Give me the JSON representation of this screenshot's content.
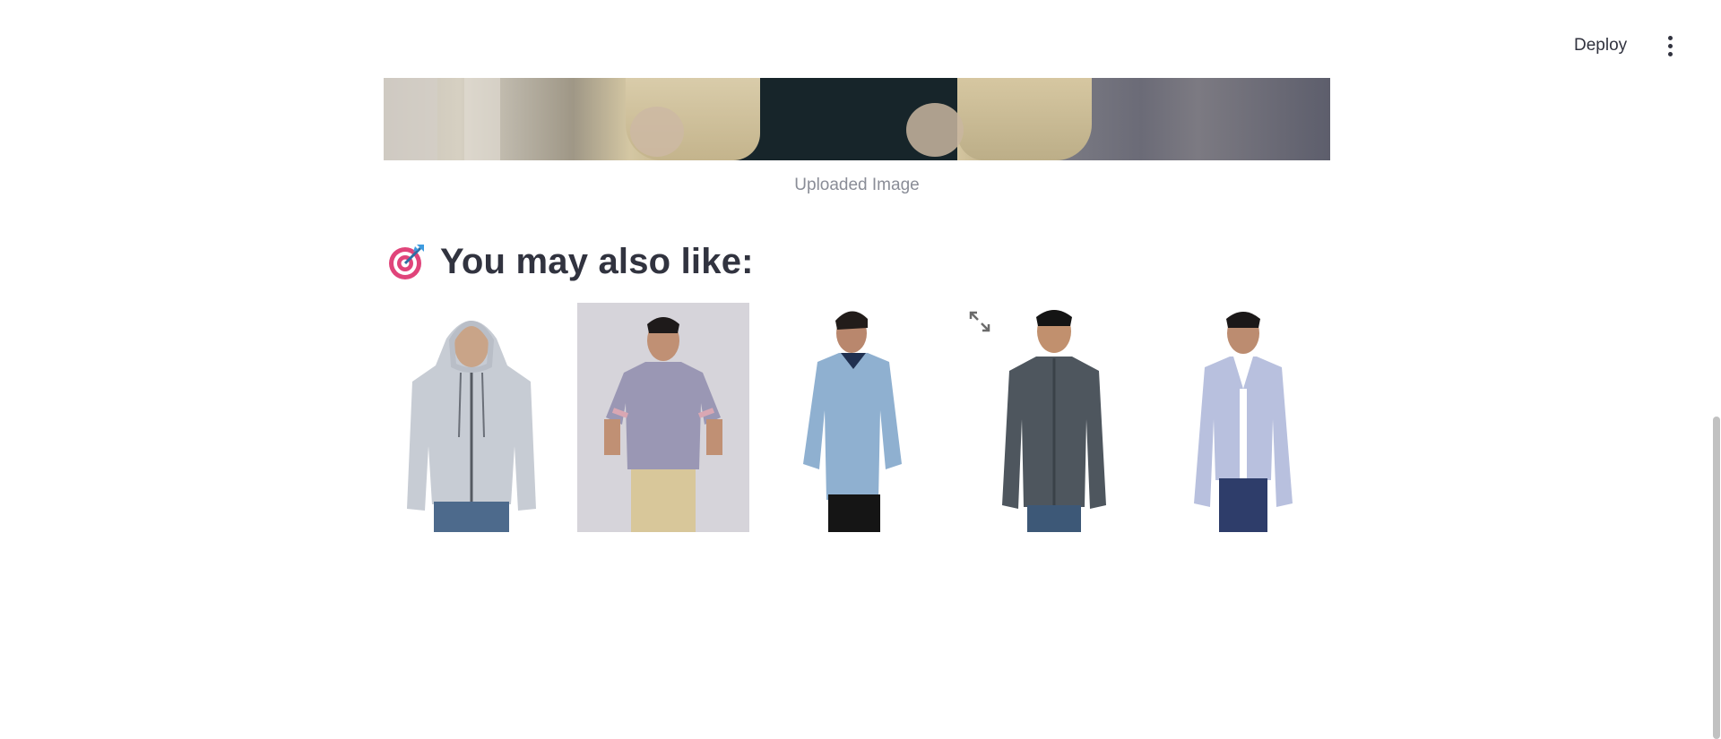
{
  "header": {
    "deploy_label": "Deploy",
    "menu_icon": "more-vertical-icon"
  },
  "uploaded": {
    "caption": "Uploaded Image"
  },
  "recommendations": {
    "icon": "target-icon",
    "title": "You may also like:",
    "items": [
      {
        "description": "light grey zip hoodie",
        "bg": "#ffffff"
      },
      {
        "description": "purple checked short sleeve shirt",
        "bg": "#d2d0d6"
      },
      {
        "description": "light blue denim shirt",
        "bg": "#ffffff"
      },
      {
        "description": "dark grey zip jacket",
        "bg": "#ffffff"
      },
      {
        "description": "lavender blazer",
        "bg": "#ffffff"
      }
    ]
  },
  "colors": {
    "text": "#31333f",
    "caption": "#8a8d97",
    "accent": "#e0447a"
  }
}
